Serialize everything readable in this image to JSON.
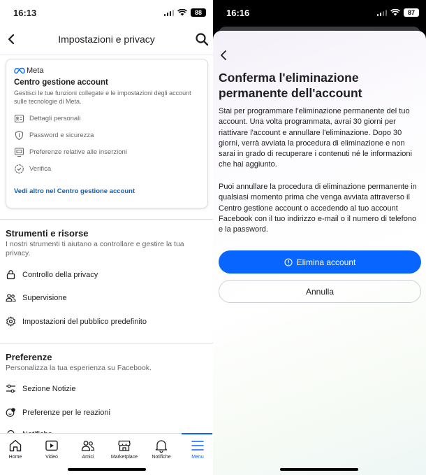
{
  "left": {
    "status": {
      "time": "16:13",
      "battery": "88"
    },
    "header": {
      "title": "Impostazioni e privacy"
    },
    "card": {
      "brand": "Meta",
      "title": "Centro gestione account",
      "description": "Gestisci le tue funzioni collegate e le impostazioni degli account sulle tecnologie di Meta.",
      "items": [
        {
          "label": "Dettagli personali",
          "icon": "id-card-icon"
        },
        {
          "label": "Password e sicurezza",
          "icon": "shield-icon"
        },
        {
          "label": "Preferenze relative alle inserzioni",
          "icon": "ad-monitor-icon"
        },
        {
          "label": "Verifica",
          "icon": "verified-badge-icon"
        }
      ],
      "link": "Vedi altro nel Centro gestione account"
    },
    "tools": {
      "title": "Strumenti e risorse",
      "description": "I nostri strumenti ti aiutano a controllare e gestire la tua privacy.",
      "items": [
        {
          "label": "Controllo della privacy",
          "icon": "lock-icon"
        },
        {
          "label": "Supervisione",
          "icon": "people-icon"
        },
        {
          "label": "Impostazioni del pubblico predefinito",
          "icon": "gear-icon"
        }
      ]
    },
    "preferences": {
      "title": "Preferenze",
      "description": "Personalizza la tua esperienza su Facebook.",
      "items": [
        {
          "label": "Sezione Notizie",
          "icon": "sliders-icon"
        },
        {
          "label": "Preferenze per le reazioni",
          "icon": "reactions-icon"
        },
        {
          "label": "Notifiche",
          "icon": "bell-icon"
        }
      ]
    },
    "tabs": [
      {
        "label": "Home",
        "icon": "home-icon"
      },
      {
        "label": "Video",
        "icon": "video-icon"
      },
      {
        "label": "Amici",
        "icon": "friends-icon"
      },
      {
        "label": "Marketplace",
        "icon": "marketplace-icon"
      },
      {
        "label": "Notifiche",
        "icon": "bell-icon"
      },
      {
        "label": "Menu",
        "icon": "menu-icon",
        "active": true
      }
    ]
  },
  "right": {
    "status": {
      "time": "16:16",
      "battery": "87"
    },
    "title": "Conferma l'eliminazione permanente dell'account",
    "paragraph1": "Stai per programmare l'eliminazione permanente del tuo account. Una volta programmata, avrai 30 giorni per riattivare l'account e annullare l'eliminazione. Dopo 30 giorni, verrà avviata la procedura di eliminazione e non sarai in grado di recuperare i contenuti né le informazioni che hai aggiunto.",
    "paragraph2": "Puoi annullare la procedura di eliminazione permanente in qualsiasi momento prima che venga avviata attraverso il Centro gestione account o accedendo al tuo account Facebook con il tuo indirizzo e-mail o il numero di telefono e la password.",
    "primary_button": "Elimina account",
    "secondary_button": "Annulla"
  },
  "colors": {
    "accent": "#0866ff",
    "link": "#0b5cbe",
    "text": "#1c1e21",
    "muted": "#65676b"
  }
}
